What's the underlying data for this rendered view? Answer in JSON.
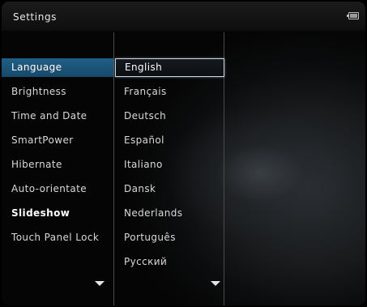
{
  "header": {
    "title": "Settings",
    "battery_icon": "battery-icon"
  },
  "settings_menu": {
    "items": [
      {
        "label": "Language"
      },
      {
        "label": "Brightness"
      },
      {
        "label": "Time and Date"
      },
      {
        "label": "SmartPower"
      },
      {
        "label": "Hibernate"
      },
      {
        "label": "Auto-orientate"
      },
      {
        "label": "Slideshow"
      },
      {
        "label": "Touch Panel Lock"
      }
    ],
    "selected": "Language",
    "more_icon": "chevron-down-icon"
  },
  "language_menu": {
    "items": [
      {
        "label": "English"
      },
      {
        "label": "Français"
      },
      {
        "label": "Deutsch"
      },
      {
        "label": "Español"
      },
      {
        "label": "Italiano"
      },
      {
        "label": "Dansk"
      },
      {
        "label": "Nederlands"
      },
      {
        "label": "Português"
      },
      {
        "label": "Русский"
      }
    ],
    "highlighted": "English",
    "more_icon": "chevron-down-icon"
  },
  "colors": {
    "selection_blue": "#1f5f86",
    "background": "#050505",
    "text": "#d9d9d9"
  }
}
